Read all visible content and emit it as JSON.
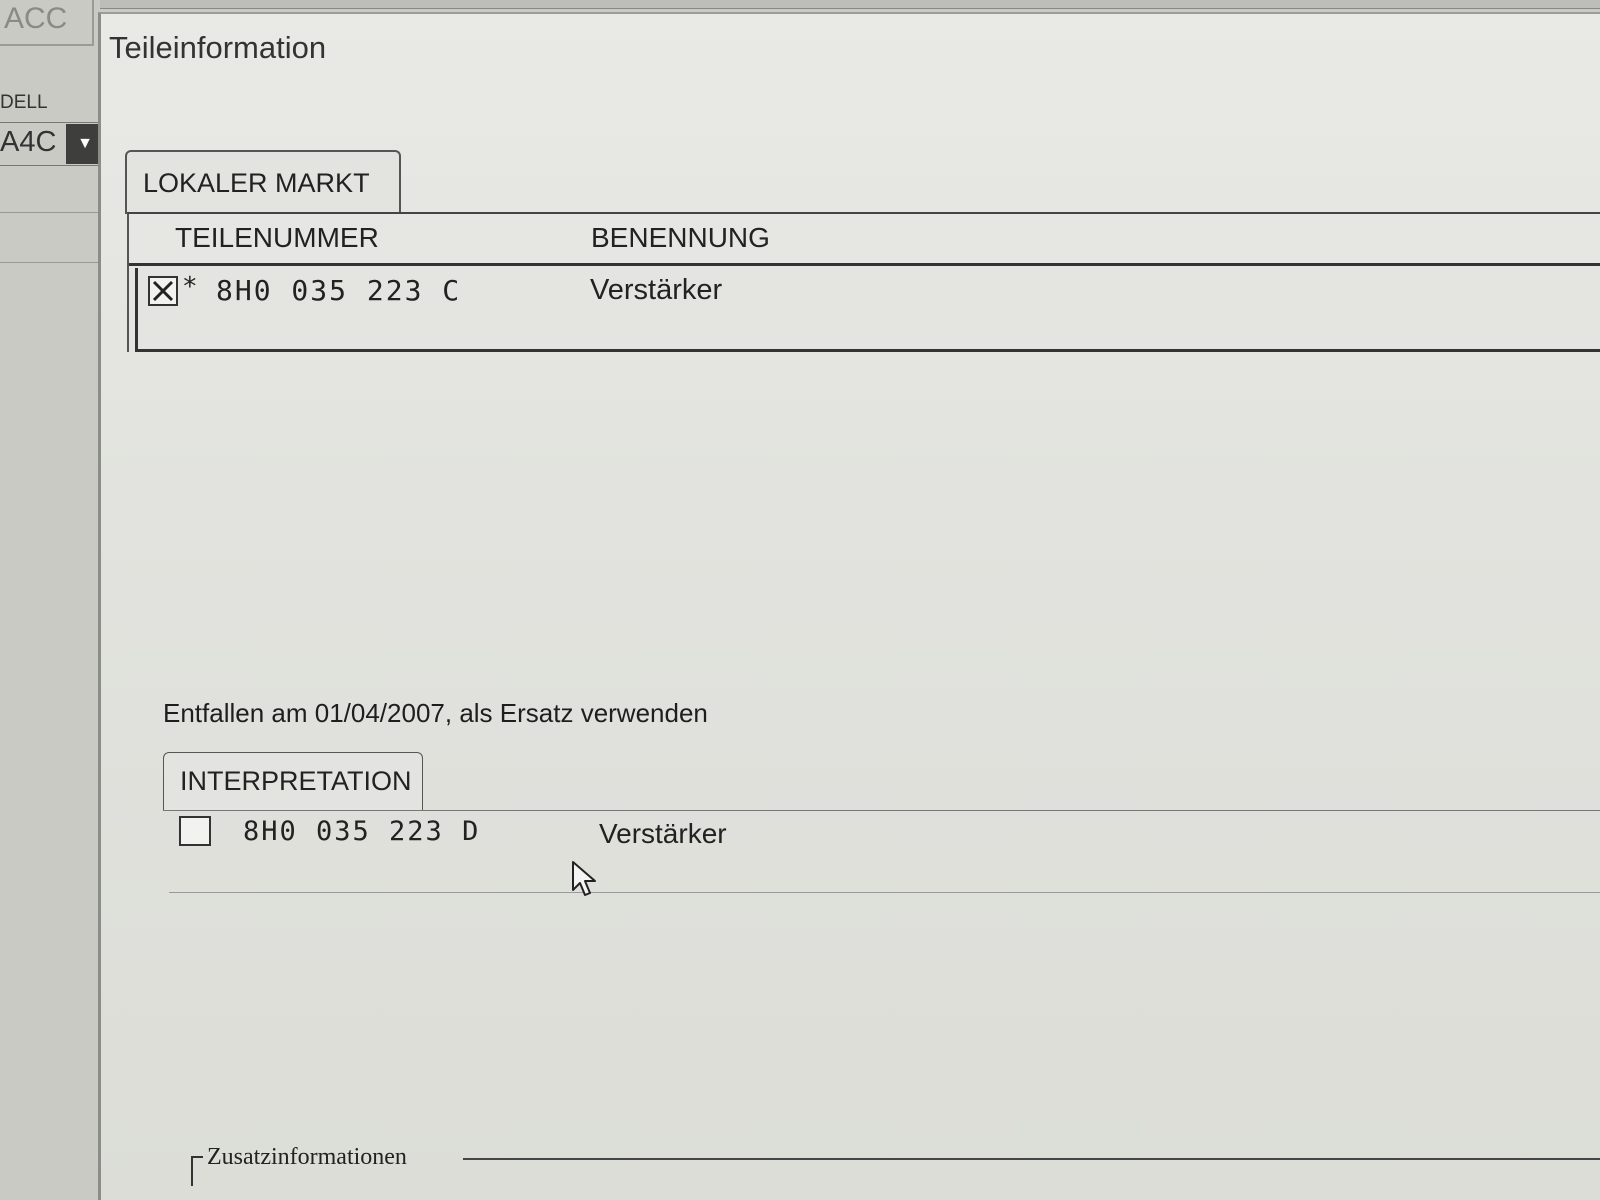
{
  "background_app": {
    "title_fragment": "ACC",
    "field_label_fragment": "DELL",
    "combo_value_fragment": "A4C"
  },
  "dialog": {
    "title": "Teileinformation"
  },
  "local_market": {
    "tab_label": "LOKALER MARKT",
    "columns": [
      "TEILENUMMER",
      "BENENNUNG"
    ],
    "rows": [
      {
        "checked": true,
        "marker": "*",
        "part_number": "8H0 035 223 C",
        "description": "Verstärker"
      }
    ]
  },
  "status": {
    "message": "Entfallen am 01/04/2007, als Ersatz verwenden"
  },
  "interpretation": {
    "tab_label": "INTERPRETATION",
    "rows": [
      {
        "checked": false,
        "part_number": "8H0 035 223 D",
        "description": "Verstärker"
      }
    ]
  },
  "additional_info": {
    "label": "Zusatzinformationen"
  }
}
